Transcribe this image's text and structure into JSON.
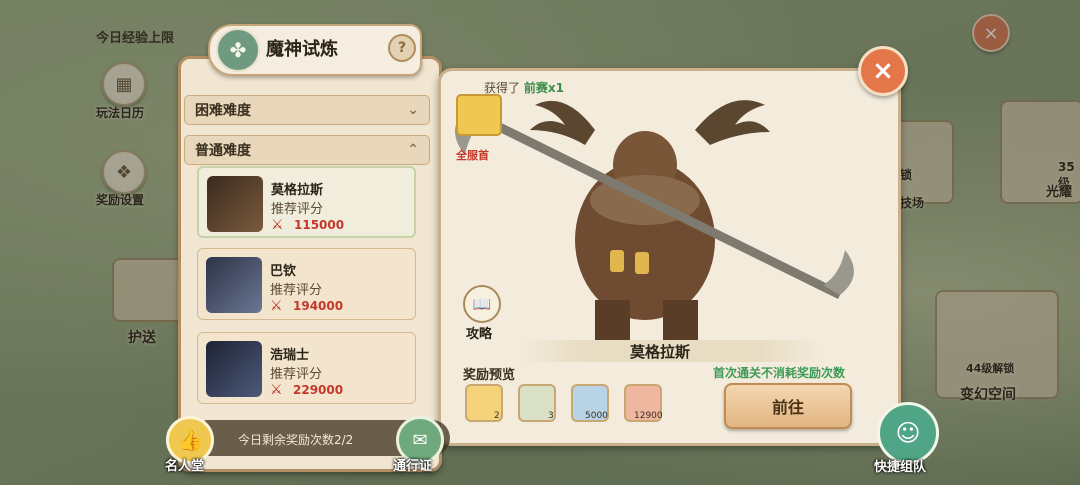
{
  "background": {
    "daily_exp_cap": "今日经验上限",
    "calendar_label": "玩法日历",
    "reward_settings_label": "奖励设置",
    "escort_label": "护送",
    "lock_label": "锁",
    "arena_label": "技场",
    "level_label_35": "35级",
    "glory_label": "光耀",
    "unlock_44": "44级解锁",
    "transform_space": "变幻空间"
  },
  "dialog": {
    "title": "魔神试炼",
    "help_icon": "?",
    "difficulty_hard": "困难难度",
    "difficulty_normal": "普通难度",
    "recommend_label": "推荐评分",
    "bosses": [
      {
        "name": "莫格拉斯",
        "power": "115000"
      },
      {
        "name": "巴钦",
        "power": "194000"
      },
      {
        "name": "浩瑞士",
        "power": "229000"
      }
    ],
    "obtained_prefix": "获得了",
    "obtained_item": "前赛x1",
    "server_label": "全服首",
    "strategy_label": "攻略",
    "boss_display_name": "莫格拉斯",
    "reward_preview": "奖励预览",
    "first_clear_note": "首次通关不消耗奖励次数",
    "reward_counts": [
      "2",
      "3",
      "5000",
      "12900"
    ],
    "go_button": "前往",
    "close_icon": "×"
  },
  "bottom": {
    "remaining_rewards": "今日剩余奖励次数2/2",
    "fame_hall": "名人堂",
    "pass": "通行证",
    "quick_team": "快捷组队"
  },
  "colors": {
    "accent_red": "#c5382a",
    "accent_green": "#3f9a58",
    "panel_bg": "#f3ebdc",
    "close_orange": "#e3774a"
  }
}
